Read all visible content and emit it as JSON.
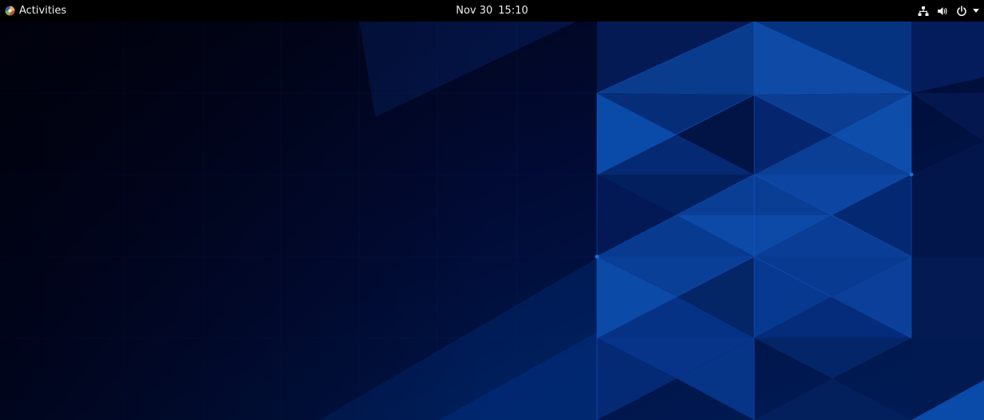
{
  "topbar": {
    "activities_label": "Activities",
    "clock": {
      "date": "Nov 30",
      "time": "15:10"
    },
    "tray": {
      "icons": [
        "network-wired-icon",
        "volume-icon",
        "power-icon",
        "chevron-down-icon"
      ]
    }
  },
  "colors": {
    "topbar_bg": "#000000",
    "topbar_text": "#eeeeec",
    "wallpaper_dark": "#020418",
    "wallpaper_mid": "#001a54",
    "wallpaper_accent": "#0a4fb3"
  }
}
